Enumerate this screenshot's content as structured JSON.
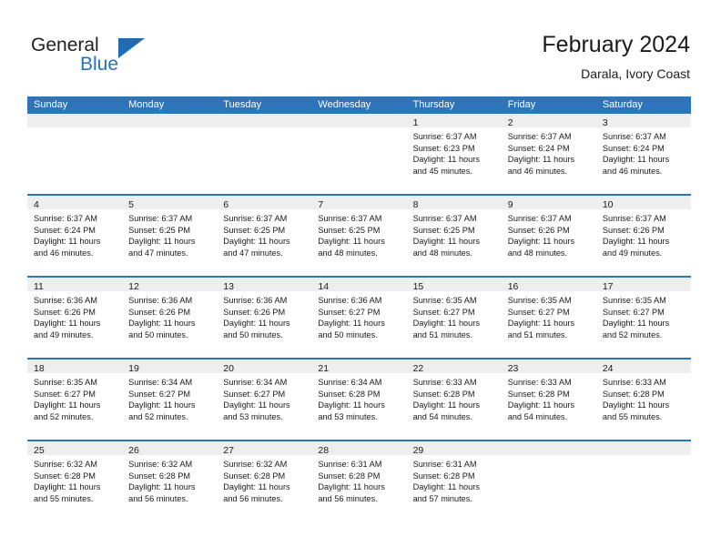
{
  "brand": {
    "name_line1": "General",
    "name_line2": "Blue",
    "triangle_color": "#1f6cb4",
    "blue_text_color": "#2572b8"
  },
  "header": {
    "title": "February 2024",
    "subtitle": "Darala, Ivory Coast"
  },
  "theme": {
    "header_row_bg": "#2d74ba",
    "header_row_text": "#ffffff",
    "day_number_band_bg": "#eeeeee",
    "week_separator": "#2d74ba",
    "cell_bg": "#ffffff",
    "text": "#1a1a1a"
  },
  "weekdays": [
    "Sunday",
    "Monday",
    "Tuesday",
    "Wednesday",
    "Thursday",
    "Friday",
    "Saturday"
  ],
  "weeks": [
    [
      {
        "day": "",
        "sunrise": "",
        "sunset": "",
        "daylight1": "",
        "daylight2": ""
      },
      {
        "day": "",
        "sunrise": "",
        "sunset": "",
        "daylight1": "",
        "daylight2": ""
      },
      {
        "day": "",
        "sunrise": "",
        "sunset": "",
        "daylight1": "",
        "daylight2": ""
      },
      {
        "day": "",
        "sunrise": "",
        "sunset": "",
        "daylight1": "",
        "daylight2": ""
      },
      {
        "day": "1",
        "sunrise": "Sunrise: 6:37 AM",
        "sunset": "Sunset: 6:23 PM",
        "daylight1": "Daylight: 11 hours",
        "daylight2": "and 45 minutes."
      },
      {
        "day": "2",
        "sunrise": "Sunrise: 6:37 AM",
        "sunset": "Sunset: 6:24 PM",
        "daylight1": "Daylight: 11 hours",
        "daylight2": "and 46 minutes."
      },
      {
        "day": "3",
        "sunrise": "Sunrise: 6:37 AM",
        "sunset": "Sunset: 6:24 PM",
        "daylight1": "Daylight: 11 hours",
        "daylight2": "and 46 minutes."
      }
    ],
    [
      {
        "day": "4",
        "sunrise": "Sunrise: 6:37 AM",
        "sunset": "Sunset: 6:24 PM",
        "daylight1": "Daylight: 11 hours",
        "daylight2": "and 46 minutes."
      },
      {
        "day": "5",
        "sunrise": "Sunrise: 6:37 AM",
        "sunset": "Sunset: 6:25 PM",
        "daylight1": "Daylight: 11 hours",
        "daylight2": "and 47 minutes."
      },
      {
        "day": "6",
        "sunrise": "Sunrise: 6:37 AM",
        "sunset": "Sunset: 6:25 PM",
        "daylight1": "Daylight: 11 hours",
        "daylight2": "and 47 minutes."
      },
      {
        "day": "7",
        "sunrise": "Sunrise: 6:37 AM",
        "sunset": "Sunset: 6:25 PM",
        "daylight1": "Daylight: 11 hours",
        "daylight2": "and 48 minutes."
      },
      {
        "day": "8",
        "sunrise": "Sunrise: 6:37 AM",
        "sunset": "Sunset: 6:25 PM",
        "daylight1": "Daylight: 11 hours",
        "daylight2": "and 48 minutes."
      },
      {
        "day": "9",
        "sunrise": "Sunrise: 6:37 AM",
        "sunset": "Sunset: 6:26 PM",
        "daylight1": "Daylight: 11 hours",
        "daylight2": "and 48 minutes."
      },
      {
        "day": "10",
        "sunrise": "Sunrise: 6:37 AM",
        "sunset": "Sunset: 6:26 PM",
        "daylight1": "Daylight: 11 hours",
        "daylight2": "and 49 minutes."
      }
    ],
    [
      {
        "day": "11",
        "sunrise": "Sunrise: 6:36 AM",
        "sunset": "Sunset: 6:26 PM",
        "daylight1": "Daylight: 11 hours",
        "daylight2": "and 49 minutes."
      },
      {
        "day": "12",
        "sunrise": "Sunrise: 6:36 AM",
        "sunset": "Sunset: 6:26 PM",
        "daylight1": "Daylight: 11 hours",
        "daylight2": "and 50 minutes."
      },
      {
        "day": "13",
        "sunrise": "Sunrise: 6:36 AM",
        "sunset": "Sunset: 6:26 PM",
        "daylight1": "Daylight: 11 hours",
        "daylight2": "and 50 minutes."
      },
      {
        "day": "14",
        "sunrise": "Sunrise: 6:36 AM",
        "sunset": "Sunset: 6:27 PM",
        "daylight1": "Daylight: 11 hours",
        "daylight2": "and 50 minutes."
      },
      {
        "day": "15",
        "sunrise": "Sunrise: 6:35 AM",
        "sunset": "Sunset: 6:27 PM",
        "daylight1": "Daylight: 11 hours",
        "daylight2": "and 51 minutes."
      },
      {
        "day": "16",
        "sunrise": "Sunrise: 6:35 AM",
        "sunset": "Sunset: 6:27 PM",
        "daylight1": "Daylight: 11 hours",
        "daylight2": "and 51 minutes."
      },
      {
        "day": "17",
        "sunrise": "Sunrise: 6:35 AM",
        "sunset": "Sunset: 6:27 PM",
        "daylight1": "Daylight: 11 hours",
        "daylight2": "and 52 minutes."
      }
    ],
    [
      {
        "day": "18",
        "sunrise": "Sunrise: 6:35 AM",
        "sunset": "Sunset: 6:27 PM",
        "daylight1": "Daylight: 11 hours",
        "daylight2": "and 52 minutes."
      },
      {
        "day": "19",
        "sunrise": "Sunrise: 6:34 AM",
        "sunset": "Sunset: 6:27 PM",
        "daylight1": "Daylight: 11 hours",
        "daylight2": "and 52 minutes."
      },
      {
        "day": "20",
        "sunrise": "Sunrise: 6:34 AM",
        "sunset": "Sunset: 6:27 PM",
        "daylight1": "Daylight: 11 hours",
        "daylight2": "and 53 minutes."
      },
      {
        "day": "21",
        "sunrise": "Sunrise: 6:34 AM",
        "sunset": "Sunset: 6:28 PM",
        "daylight1": "Daylight: 11 hours",
        "daylight2": "and 53 minutes."
      },
      {
        "day": "22",
        "sunrise": "Sunrise: 6:33 AM",
        "sunset": "Sunset: 6:28 PM",
        "daylight1": "Daylight: 11 hours",
        "daylight2": "and 54 minutes."
      },
      {
        "day": "23",
        "sunrise": "Sunrise: 6:33 AM",
        "sunset": "Sunset: 6:28 PM",
        "daylight1": "Daylight: 11 hours",
        "daylight2": "and 54 minutes."
      },
      {
        "day": "24",
        "sunrise": "Sunrise: 6:33 AM",
        "sunset": "Sunset: 6:28 PM",
        "daylight1": "Daylight: 11 hours",
        "daylight2": "and 55 minutes."
      }
    ],
    [
      {
        "day": "25",
        "sunrise": "Sunrise: 6:32 AM",
        "sunset": "Sunset: 6:28 PM",
        "daylight1": "Daylight: 11 hours",
        "daylight2": "and 55 minutes."
      },
      {
        "day": "26",
        "sunrise": "Sunrise: 6:32 AM",
        "sunset": "Sunset: 6:28 PM",
        "daylight1": "Daylight: 11 hours",
        "daylight2": "and 56 minutes."
      },
      {
        "day": "27",
        "sunrise": "Sunrise: 6:32 AM",
        "sunset": "Sunset: 6:28 PM",
        "daylight1": "Daylight: 11 hours",
        "daylight2": "and 56 minutes."
      },
      {
        "day": "28",
        "sunrise": "Sunrise: 6:31 AM",
        "sunset": "Sunset: 6:28 PM",
        "daylight1": "Daylight: 11 hours",
        "daylight2": "and 56 minutes."
      },
      {
        "day": "29",
        "sunrise": "Sunrise: 6:31 AM",
        "sunset": "Sunset: 6:28 PM",
        "daylight1": "Daylight: 11 hours",
        "daylight2": "and 57 minutes."
      },
      {
        "day": "",
        "sunrise": "",
        "sunset": "",
        "daylight1": "",
        "daylight2": ""
      },
      {
        "day": "",
        "sunrise": "",
        "sunset": "",
        "daylight1": "",
        "daylight2": ""
      }
    ]
  ]
}
